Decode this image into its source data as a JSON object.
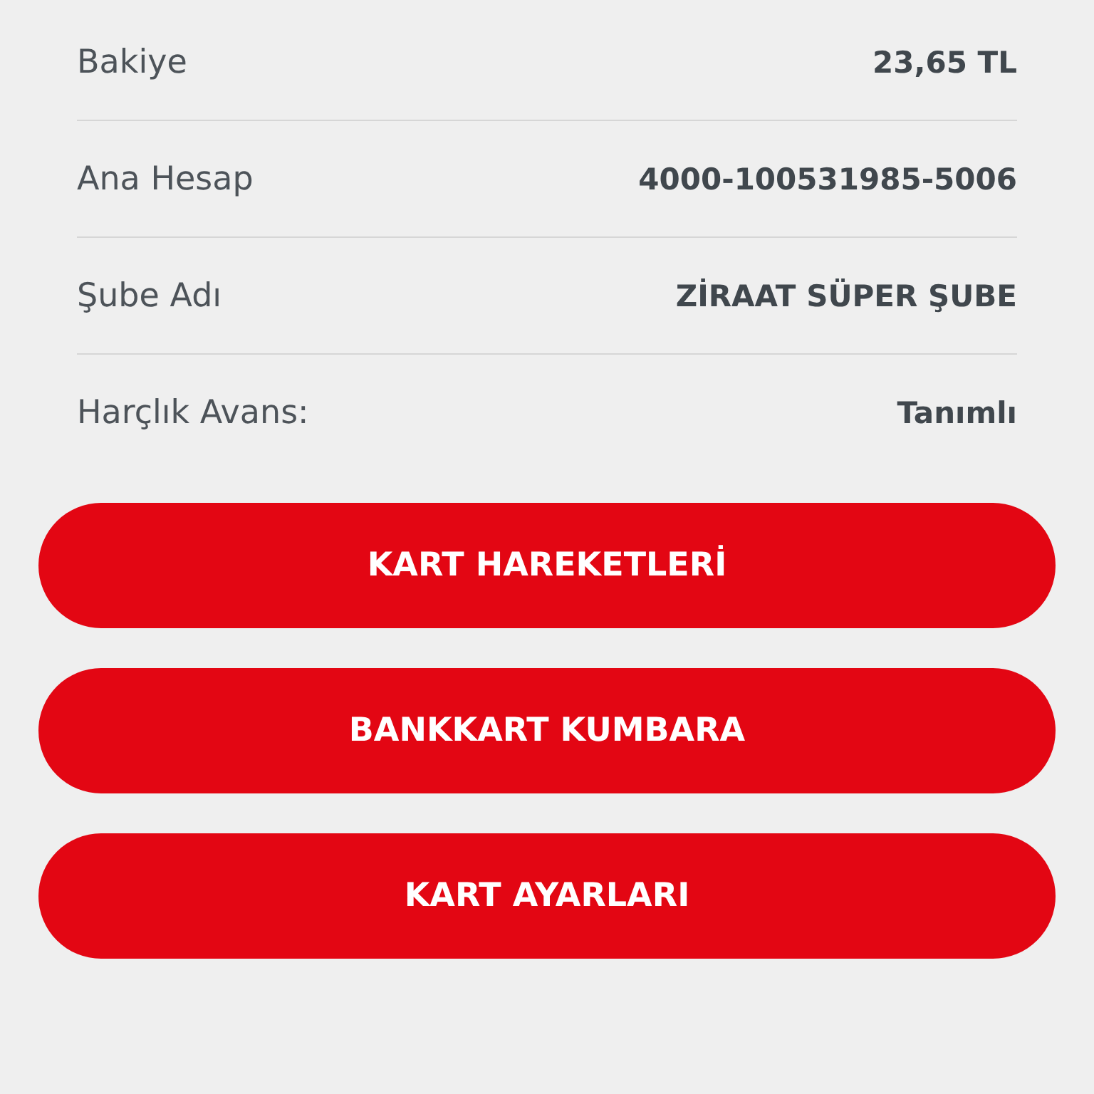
{
  "details": [
    {
      "label": "Bakiye",
      "value": "23,65 TL"
    },
    {
      "label": "Ana Hesap",
      "value": "4000-100531985-5006"
    },
    {
      "label": "Şube Adı",
      "value": "ZİRAAT SÜPER ŞUBE"
    },
    {
      "label": "Harçlık Avans:",
      "value": "Tanımlı"
    }
  ],
  "buttons": [
    "KART HAREKETLERİ",
    "BANKKART KUMBARA",
    "KART AYARLARI"
  ]
}
